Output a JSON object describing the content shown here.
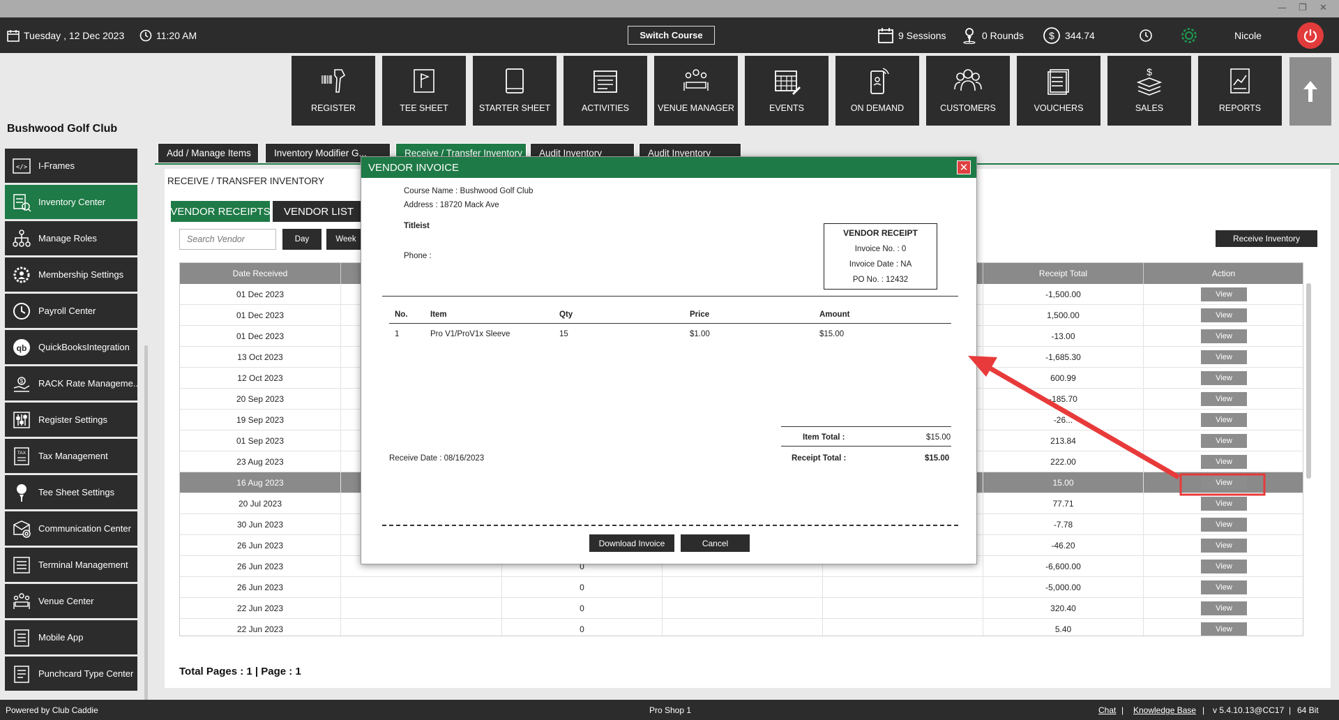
{
  "topbar": {
    "date": "Tuesday ,  12 Dec 2023",
    "time": "11:20 AM",
    "switch_course": "Switch Course",
    "sessions": "9 Sessions",
    "rounds": "0 Rounds",
    "balance": "344.74",
    "user": "Nicole"
  },
  "ribbon": [
    {
      "label": "Register",
      "icon": "barcode-scanner-icon"
    },
    {
      "label": "Tee Sheet",
      "icon": "tee-sheet-icon"
    },
    {
      "label": "Starter Sheet",
      "icon": "tablet-icon"
    },
    {
      "label": "Activities",
      "icon": "activities-icon"
    },
    {
      "label": "Venue Manager",
      "icon": "venue-icon"
    },
    {
      "label": "Events",
      "icon": "calendar-icon"
    },
    {
      "label": "On Demand",
      "icon": "phone-icon"
    },
    {
      "label": "Customers",
      "icon": "customers-icon"
    },
    {
      "label": "Vouchers",
      "icon": "vouchers-icon"
    },
    {
      "label": "Sales",
      "icon": "sales-icon"
    },
    {
      "label": "Reports",
      "icon": "reports-icon"
    }
  ],
  "club_name": "Bushwood Golf Club",
  "sidebar": [
    {
      "label": "I-Frames",
      "active": false
    },
    {
      "label": "Inventory Center",
      "active": true
    },
    {
      "label": "Manage Roles",
      "active": false
    },
    {
      "label": "Membership Settings",
      "active": false
    },
    {
      "label": "Payroll Center",
      "active": false
    },
    {
      "label": "QuickBooksIntegration",
      "active": false
    },
    {
      "label": "RACK Rate Manageme...",
      "active": false
    },
    {
      "label": "Register Settings",
      "active": false
    },
    {
      "label": "Tax Management",
      "active": false
    },
    {
      "label": "Tee Sheet Settings",
      "active": false
    },
    {
      "label": "Communication Center",
      "active": false
    },
    {
      "label": "Terminal Management",
      "active": false
    },
    {
      "label": "Venue Center",
      "active": false
    },
    {
      "label": "Mobile App",
      "active": false
    },
    {
      "label": "Punchcard Type Center",
      "active": false
    }
  ],
  "main": {
    "tabs": [
      "Add / Manage Items",
      "Inventory Modifier G...",
      "Receive / Transfer Inventory",
      "Audit Inventory",
      "Audit Inventory"
    ],
    "section_title": "RECEIVE / TRANSFER INVENTORY",
    "subtabs": [
      "VENDOR RECEIPTS",
      "VENDOR LIST"
    ],
    "search_placeholder": "Search Vendor",
    "filter_day": "Day",
    "filter_week": "Week",
    "receive_button": "Receive Inventory",
    "columns": [
      "Date Received",
      "",
      "",
      "",
      "",
      "Receipt Total",
      "Action"
    ],
    "rows": [
      {
        "date": "01 Dec 2023",
        "qty": "",
        "total": "-1,500.00",
        "action": "View"
      },
      {
        "date": "01 Dec 2023",
        "qty": "",
        "total": "1,500.00",
        "action": "View"
      },
      {
        "date": "01 Dec 2023",
        "qty": "",
        "total": "-13.00",
        "action": "View"
      },
      {
        "date": "13 Oct 2023",
        "qty": "",
        "total": "-1,685.30",
        "action": "View"
      },
      {
        "date": "12 Oct 2023",
        "qty": "",
        "total": "600.99",
        "action": "View"
      },
      {
        "date": "20 Sep 2023",
        "qty": "",
        "total": "-185.70",
        "action": "View"
      },
      {
        "date": "19 Sep 2023",
        "qty": "",
        "total": "-26...",
        "action": "View"
      },
      {
        "date": "01 Sep 2023",
        "qty": "",
        "total": "213.84",
        "action": "View"
      },
      {
        "date": "23 Aug 2023",
        "qty": "",
        "total": "222.00",
        "action": "View"
      },
      {
        "date": "16 Aug 2023",
        "qty": "",
        "total": "15.00",
        "action": "View",
        "selected": true
      },
      {
        "date": "20 Jul 2023",
        "qty": "",
        "total": "77.71",
        "action": "View"
      },
      {
        "date": "30 Jun 2023",
        "qty": "",
        "total": "-7.78",
        "action": "View"
      },
      {
        "date": "26 Jun 2023",
        "qty": "",
        "total": "-46.20",
        "action": "View"
      },
      {
        "date": "26 Jun 2023",
        "qty": "0",
        "total": "-6,600.00",
        "action": "View"
      },
      {
        "date": "26 Jun 2023",
        "qty": "0",
        "total": "-5,000.00",
        "action": "View"
      },
      {
        "date": "22 Jun 2023",
        "qty": "0",
        "total": "320.40",
        "action": "View"
      },
      {
        "date": "22 Jun 2023",
        "qty": "0",
        "total": "5.40",
        "action": "View"
      }
    ],
    "pages": "Total Pages : 1 | Page : 1"
  },
  "modal": {
    "title": "VENDOR INVOICE",
    "course_name": "Course Name : Bushwood Golf Club",
    "address": "Address : 18720 Mack Ave",
    "vendor": "Titleist",
    "phone": "Phone :",
    "receipt": {
      "heading": "VENDOR RECEIPT",
      "invoice_no": "Invoice No. : 0",
      "invoice_date": "Invoice Date : NA",
      "po_no": "PO No. : 12432"
    },
    "columns": [
      "No.",
      "Item",
      "Qty",
      "Price",
      "Amount"
    ],
    "items": [
      {
        "no": "1",
        "item": "Pro V1/ProV1x Sleeve",
        "qty": "15",
        "price": "$1.00",
        "amount": "$15.00"
      }
    ],
    "item_total_label": "Item Total :",
    "item_total": "$15.00",
    "receipt_total_label": "Receipt Total :",
    "receipt_total": "$15.00",
    "receive_date": "Receive Date : 08/16/2023",
    "download_button": "Download Invoice",
    "cancel_button": "Cancel"
  },
  "status": {
    "powered": "Powered by Club Caddie",
    "shop": "Pro Shop 1",
    "chat": "Chat",
    "kb": "Knowledge Base",
    "version": "v 5.4.10.13@CC17",
    "bits": "64 Bit"
  },
  "colors": {
    "accent": "#1e7a46",
    "dark": "#2c2c2c",
    "annotation": "#e83a3a"
  }
}
